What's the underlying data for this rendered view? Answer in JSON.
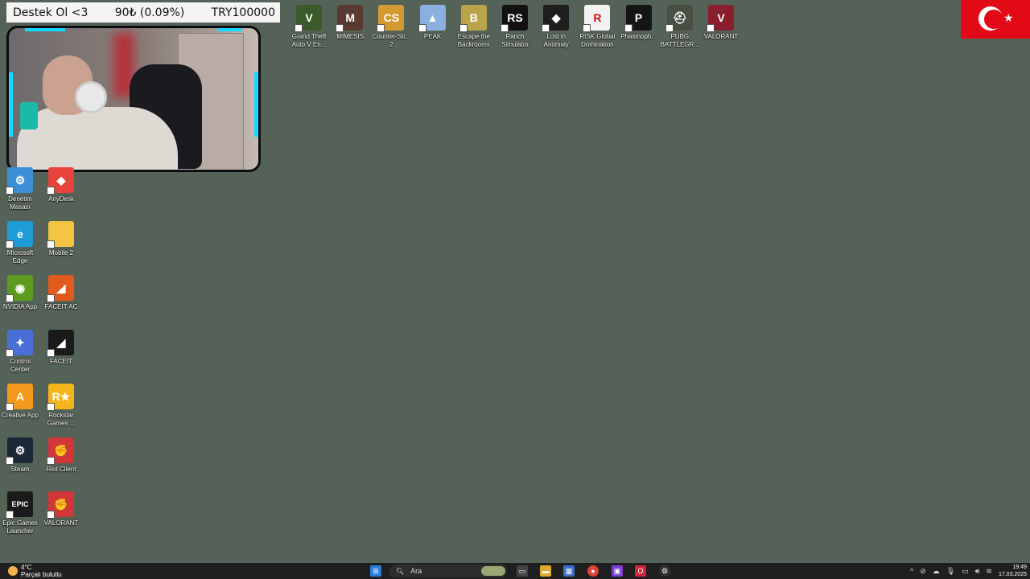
{
  "overlay": {
    "goal_text": "Destek Ol <3",
    "progress_text": "90₺ (0.09%)",
    "goal_amount": "TRY100000",
    "progress_fraction": 0.0009
  },
  "desktop": {
    "top_icons": [
      {
        "label": "Grand Theft Auto V En...",
        "icon": "gta-v-icon",
        "color": "#3b5b2a",
        "glyph": "V"
      },
      {
        "label": "MIMESIS",
        "icon": "mimesis-icon",
        "color": "#5a3a30",
        "glyph": "M"
      },
      {
        "label": "Counter-Str... 2",
        "icon": "counter-strike-icon",
        "color": "#d49a32",
        "glyph": "CS"
      },
      {
        "label": "PEAK",
        "icon": "peak-icon",
        "color": "#8bb0e0",
        "glyph": "▲"
      },
      {
        "label": "Escape the Backrooms",
        "icon": "escape-backrooms-icon",
        "color": "#b9a44a",
        "glyph": "B"
      },
      {
        "label": "Ranch Simulator",
        "icon": "ranch-simulator-icon",
        "color": "#111111",
        "glyph": "RS"
      },
      {
        "label": "Lost in Anomaly",
        "icon": "lost-in-anomaly-icon",
        "color": "#1e1e1e",
        "glyph": "◆"
      },
      {
        "label": "RISK Global Domination",
        "icon": "risk-icon",
        "color": "#f2f2f2",
        "glyph": "R"
      },
      {
        "label": "Phasmoph...",
        "icon": "phasmophobia-icon",
        "color": "#151515",
        "glyph": "P"
      },
      {
        "label": "PUBG BATTLEGR...",
        "icon": "pubg-icon",
        "color": "#4a4f43",
        "glyph": "⛑"
      },
      {
        "label": "VALORANT",
        "icon": "valorant-icon",
        "color": "#8a1f2e",
        "glyph": "V"
      }
    ],
    "left_icons": [
      {
        "label": "Denetim Masası",
        "icon": "control-panel-icon",
        "color": "#3a8fd6",
        "glyph": "⚙"
      },
      {
        "label": "AnyDesk",
        "icon": "anydesk-icon",
        "color": "#e8433b",
        "glyph": "◆"
      },
      {
        "label": "Microsoft Edge",
        "icon": "edge-icon",
        "color": "#1f9bd8",
        "glyph": "e"
      },
      {
        "label": "Mobile 2",
        "icon": "folder-icon",
        "color": "#f4c542",
        "glyph": ""
      },
      {
        "label": "NVIDIA App",
        "icon": "nvidia-icon",
        "color": "#5d9b1e",
        "glyph": "◉"
      },
      {
        "label": "FACEIT AC",
        "icon": "faceit-ac-icon",
        "color": "#e25a1c",
        "glyph": "◢"
      },
      {
        "label": "Control Center",
        "icon": "control-center-icon",
        "color": "#4a6fd8",
        "glyph": "✦"
      },
      {
        "label": "FACEIT",
        "icon": "faceit-icon",
        "color": "#1a1a1a",
        "glyph": "◢"
      },
      {
        "label": "Creative App",
        "icon": "creative-app-icon",
        "color": "#f39a1c",
        "glyph": "A"
      },
      {
        "label": "Rockstar Games ...",
        "icon": "rockstar-icon",
        "color": "#f4b41c",
        "glyph": "R★"
      },
      {
        "label": "Steam",
        "icon": "steam-icon",
        "color": "#1b2838",
        "glyph": "⚙"
      },
      {
        "label": "Riot Client",
        "icon": "riot-client-icon",
        "color": "#d13639",
        "glyph": "✊"
      },
      {
        "label": "Epic Games Launcher",
        "icon": "epic-games-icon",
        "color": "#1a1a1a",
        "glyph": "EPIC"
      },
      {
        "label": "VALORANT",
        "icon": "riot-valorant-icon",
        "color": "#d13639",
        "glyph": "✊"
      }
    ]
  },
  "taskbar": {
    "weather_temp": "4°C",
    "weather_desc": "Parçalı bulutlu",
    "search_placeholder": "Ara",
    "clock_time": "19:49",
    "clock_date": "17.03.2025",
    "apps": [
      "start-icon",
      "task-view-icon",
      "file-explorer-icon",
      "store-icon",
      "chrome-icon",
      "twitch-icon",
      "opera-icon",
      "steam-overlay-icon"
    ]
  },
  "colors": {
    "desktop_bg": "#556257",
    "accent_cyan": "#19d8ff",
    "flag_red": "#e30a17"
  }
}
